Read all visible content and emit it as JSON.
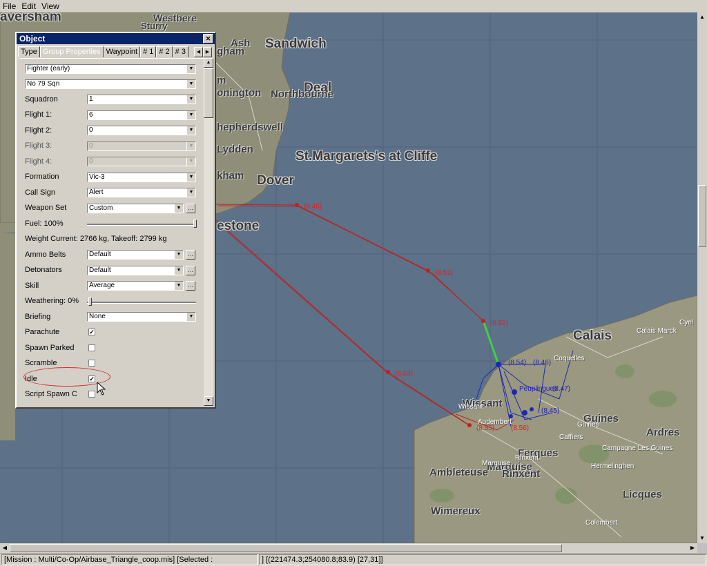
{
  "menu": [
    "File",
    "Edit",
    "View"
  ],
  "map": {
    "places_big": [
      {
        "name": "aversham"
      },
      {
        "name": "Sandwich"
      },
      {
        "name": "Deal"
      },
      {
        "name": "St.Margarets's at Cliffe"
      },
      {
        "name": "Dover"
      },
      {
        "name": "estone"
      },
      {
        "name": "Calais"
      },
      {
        "name": "Guines"
      },
      {
        "name": "Ardres"
      },
      {
        "name": "Licques"
      },
      {
        "name": "Wimereux"
      },
      {
        "name": "Ambleteuse"
      },
      {
        "name": "Marquise"
      },
      {
        "name": "Rinxent"
      },
      {
        "name": "Ferques"
      },
      {
        "name": "Wissant"
      }
    ],
    "places_mid": [
      {
        "name": "Westbere"
      },
      {
        "name": "Sturry"
      },
      {
        "name": "Ash"
      },
      {
        "name": "gham"
      },
      {
        "name": "m"
      },
      {
        "name": "onington"
      },
      {
        "name": "Northbourne"
      },
      {
        "name": "hepherdswell"
      },
      {
        "name": "Lydden"
      },
      {
        "name": "kham"
      }
    ],
    "places_small": [
      {
        "name": "Calais Marck"
      },
      {
        "name": "Coquelles"
      },
      {
        "name": "Peuplingues"
      },
      {
        "name": "Guines"
      },
      {
        "name": "Campagne Les Guines"
      },
      {
        "name": "Hermelinghen"
      },
      {
        "name": "Caffiers"
      },
      {
        "name": "Colembert"
      },
      {
        "name": "Marquise"
      },
      {
        "name": "Rinxent"
      },
      {
        "name": "Audembert"
      },
      {
        "name": "Wissant"
      },
      {
        "name": "Cyel"
      }
    ],
    "waypoints_red": [
      {
        "text": "(8.46)"
      },
      {
        "text": "(8.51)"
      },
      {
        "text": "(8.52)"
      },
      {
        "text": "(8.53)"
      },
      {
        "text": "(8.55)"
      },
      {
        "text": "(8.56)"
      }
    ],
    "waypoints_blue": [
      {
        "text": "(8.46)"
      },
      {
        "text": "(8.47)"
      },
      {
        "text": "(8.45)"
      },
      {
        "text": "(8.54)"
      }
    ]
  },
  "dialog": {
    "title": "Object",
    "tabs": [
      "Type",
      "Group Properties",
      "Waypoint",
      "# 1",
      "# 2",
      "# 3"
    ],
    "active_tab": "Group Properties",
    "class_value": "Fighter (early)",
    "regiment_value": "No 79 Sqn",
    "squadron_label": "Squadron",
    "squadron_value": "1",
    "flight1_label": "Flight 1:",
    "flight1_value": "6",
    "flight2_label": "Flight 2:",
    "flight2_value": "0",
    "flight3_label": "Flight 3:",
    "flight3_value": "0",
    "flight4_label": "Flight 4:",
    "flight4_value": "0",
    "formation_label": "Formation",
    "formation_value": "Vic-3",
    "callsign_label": "Call Sign",
    "callsign_value": "Alert",
    "weaponset_label": "Weapon Set",
    "weaponset_value": "Custom",
    "fuel_label": "Fuel: 100%",
    "fuel_level": 1.0,
    "weight_label": "Weight  Current: 2766 kg, Takeoff: 2799 kg",
    "ammo_label": "Ammo Belts",
    "ammo_value": "Default",
    "detonators_label": "Detonators",
    "detonators_value": "Default",
    "skill_label": "Skill",
    "skill_value": "Average",
    "weathering_label": "Weathering: 0%",
    "weathering_level": 0.0,
    "briefing_label": "Briefing",
    "briefing_value": "None",
    "parachute_label": "Parachute",
    "parachute_checked": true,
    "spawnparked_label": "Spawn Parked",
    "spawnparked_checked": false,
    "scramble_label": "Scramble",
    "scramble_checked": false,
    "idle_label": "Idle",
    "idle_checked": true,
    "scriptspawn_label": "Script Spawn C",
    "scriptspawn_checked": false
  },
  "status": {
    "mission": "[Mission : Multi/Co-Op/Airbase_Triangle_coop.mis] [Selected :",
    "coords": "] [(221474.3;254080.8;83.9) [27,31]]"
  },
  "colors": {
    "sea": "#5b7088",
    "land": "#9a9880",
    "route_red": "#c02020",
    "route_blue": "#1a2ab0",
    "selected_green": "#40d040"
  }
}
